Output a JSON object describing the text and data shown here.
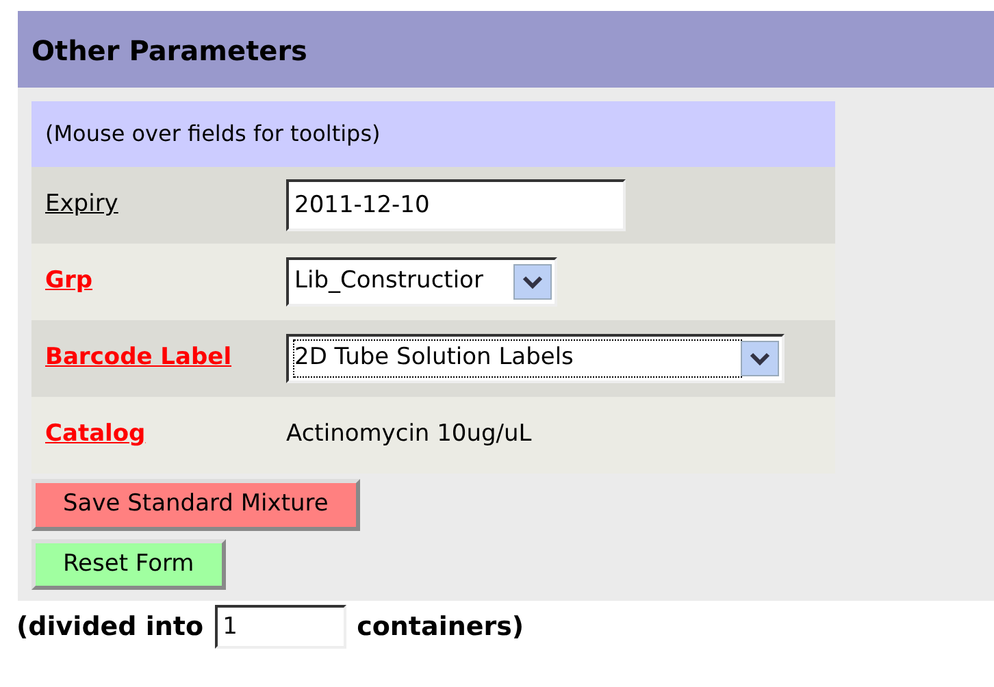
{
  "panel": {
    "title": "Other Parameters",
    "note": "(Mouse over fields for tooltips)",
    "fields": [
      {
        "label": "Expiry",
        "required": false,
        "kind": "text",
        "value": "2011-12-10"
      },
      {
        "label": "Grp",
        "required": true,
        "kind": "select",
        "value": "Lib_Constructior"
      },
      {
        "label": "Barcode Label",
        "required": true,
        "kind": "select-wide",
        "value": "2D Tube Solution Labels"
      },
      {
        "label": "Catalog",
        "required": true,
        "kind": "static",
        "value": "Actinomycin 10ug/uL"
      }
    ],
    "buttons": [
      {
        "label": "Save Standard Mixture",
        "kind": "save"
      },
      {
        "label": "Reset Form",
        "kind": "reset"
      }
    ]
  },
  "divide": {
    "prefix": "(divided into",
    "value": "1",
    "suffix": "containers)"
  }
}
